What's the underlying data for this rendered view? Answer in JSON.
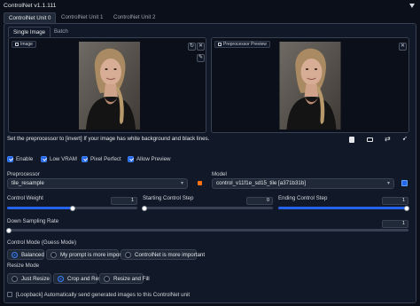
{
  "header": {
    "title": "ControlNet v1.1.111",
    "collapse_icon": "triangle-down-icon"
  },
  "units": [
    {
      "label": "ControlNet Unit 0",
      "active": true
    },
    {
      "label": "ControlNet Unit 1",
      "active": false
    },
    {
      "label": "ControlNet Unit 2",
      "active": false
    }
  ],
  "image_tabs": [
    {
      "label": "Single Image",
      "active": true
    },
    {
      "label": "Batch",
      "active": false
    }
  ],
  "image_panel": {
    "label": "Image"
  },
  "preview_panel": {
    "label": "Preprocessor Preview"
  },
  "hint": "Set the preprocessor to [invert] If your image has white background and black lines.",
  "checkboxes": {
    "enable": "Enable",
    "low_vram": "Low VRAM",
    "pixel_perfect": "Pixel Perfect",
    "allow_preview": "Allow Preview"
  },
  "preprocessor": {
    "label": "Preprocessor",
    "value": "tile_resample"
  },
  "model": {
    "label": "Model",
    "value": "control_v11f1e_sd15_tile [a371b31b]"
  },
  "sliders": {
    "control_weight": {
      "label": "Control Weight",
      "value": "1",
      "fraction": 0.5
    },
    "starting_step": {
      "label": "Starting Control Step",
      "value": "0",
      "fraction": 0.0
    },
    "ending_step": {
      "label": "Ending Control Step",
      "value": "1",
      "fraction": 1.0
    },
    "down_sampling": {
      "label": "Down Sampling Rate",
      "value": "1",
      "fraction": 0.0
    }
  },
  "control_mode": {
    "label": "Control Mode (Guess Mode)",
    "options": [
      "Balanced",
      "My prompt is more important",
      "ControlNet is more important"
    ],
    "selected": "Balanced"
  },
  "resize_mode": {
    "label": "Resize Mode",
    "options": [
      "Just Resize",
      "Crop and Resize",
      "Resize and Fill"
    ],
    "selected": "Crop and Resize"
  },
  "loopback": "[Loopback] Automatically send generated images to this ControlNet unit",
  "colors": {
    "accent": "#2563eb",
    "background": "#0b0f19",
    "panel": "#1f2937",
    "border": "#374151"
  }
}
